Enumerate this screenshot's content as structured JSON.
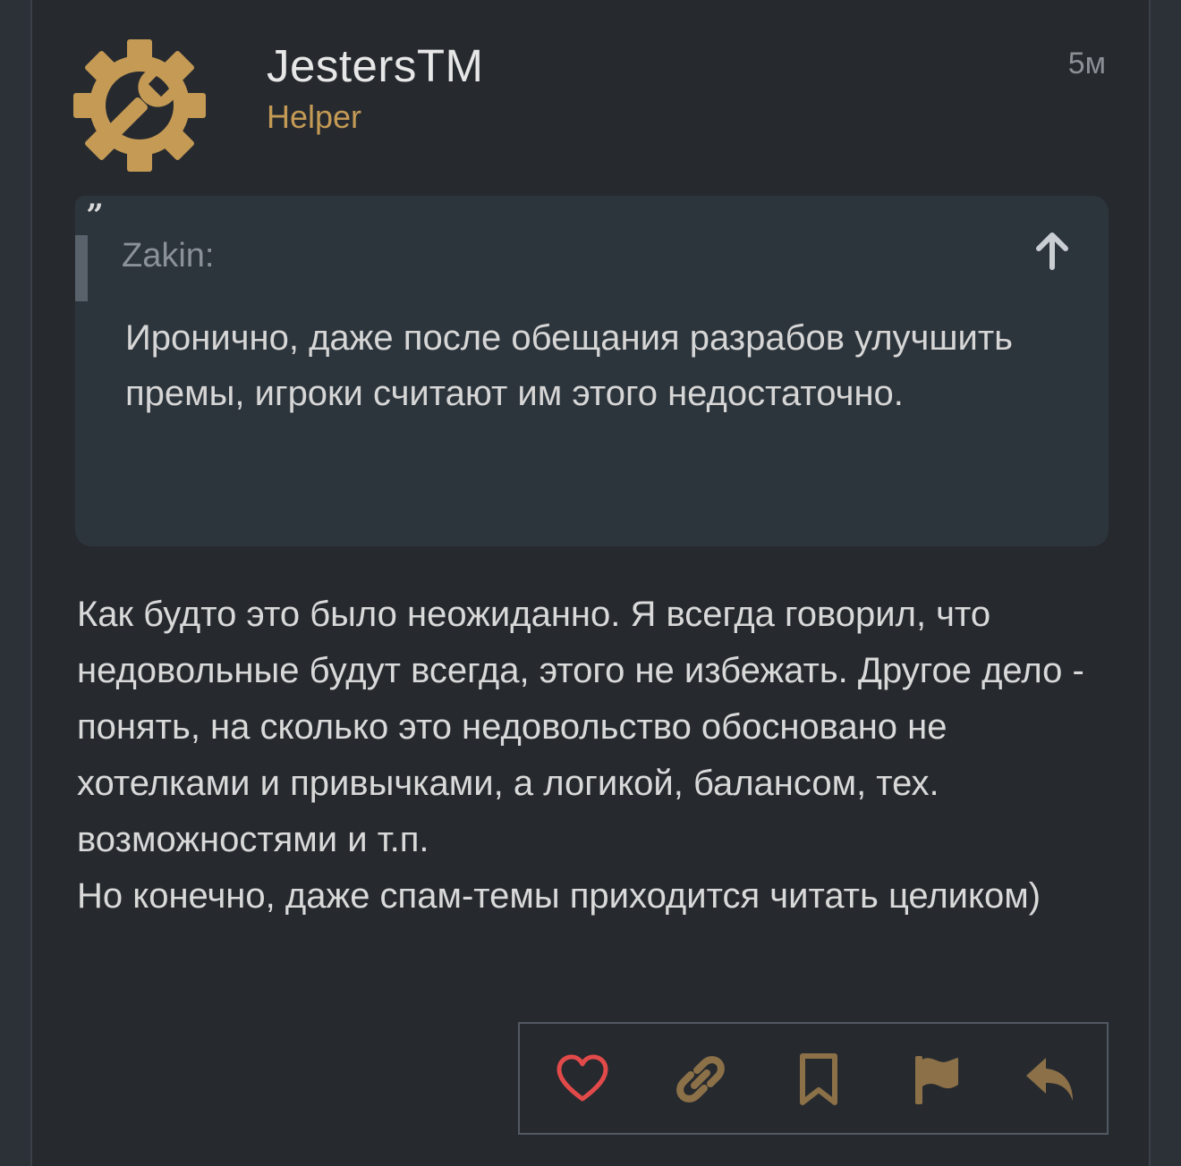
{
  "post": {
    "username": "JestersTM",
    "role": "Helper",
    "time": "5м",
    "quote": {
      "mark": "”",
      "author": "Zakin:",
      "text": "Иронично, даже после обещания разрабов улучшить премы, игроки считают им этого недостаточно."
    },
    "message": "Как будто это было неожиданно. Я всегда говорил, что недовольные будут всегда, этого не избежать. Другое дело - понять, на сколько это недовольство обосновано не хотелками и привычками, а логикой, балансом, тех. возможностями и т.п.\nНо конечно, даже спам-темы приходится читать целиком)",
    "actions": [
      "heart-icon",
      "link-icon",
      "bookmark-icon",
      "flag-icon",
      "reply-icon"
    ]
  },
  "colors": {
    "background": "#262a2f",
    "accent": "#c49a55",
    "icon": "#8b7048",
    "like": "#e24a4a",
    "quote_background": "#2d353c"
  }
}
